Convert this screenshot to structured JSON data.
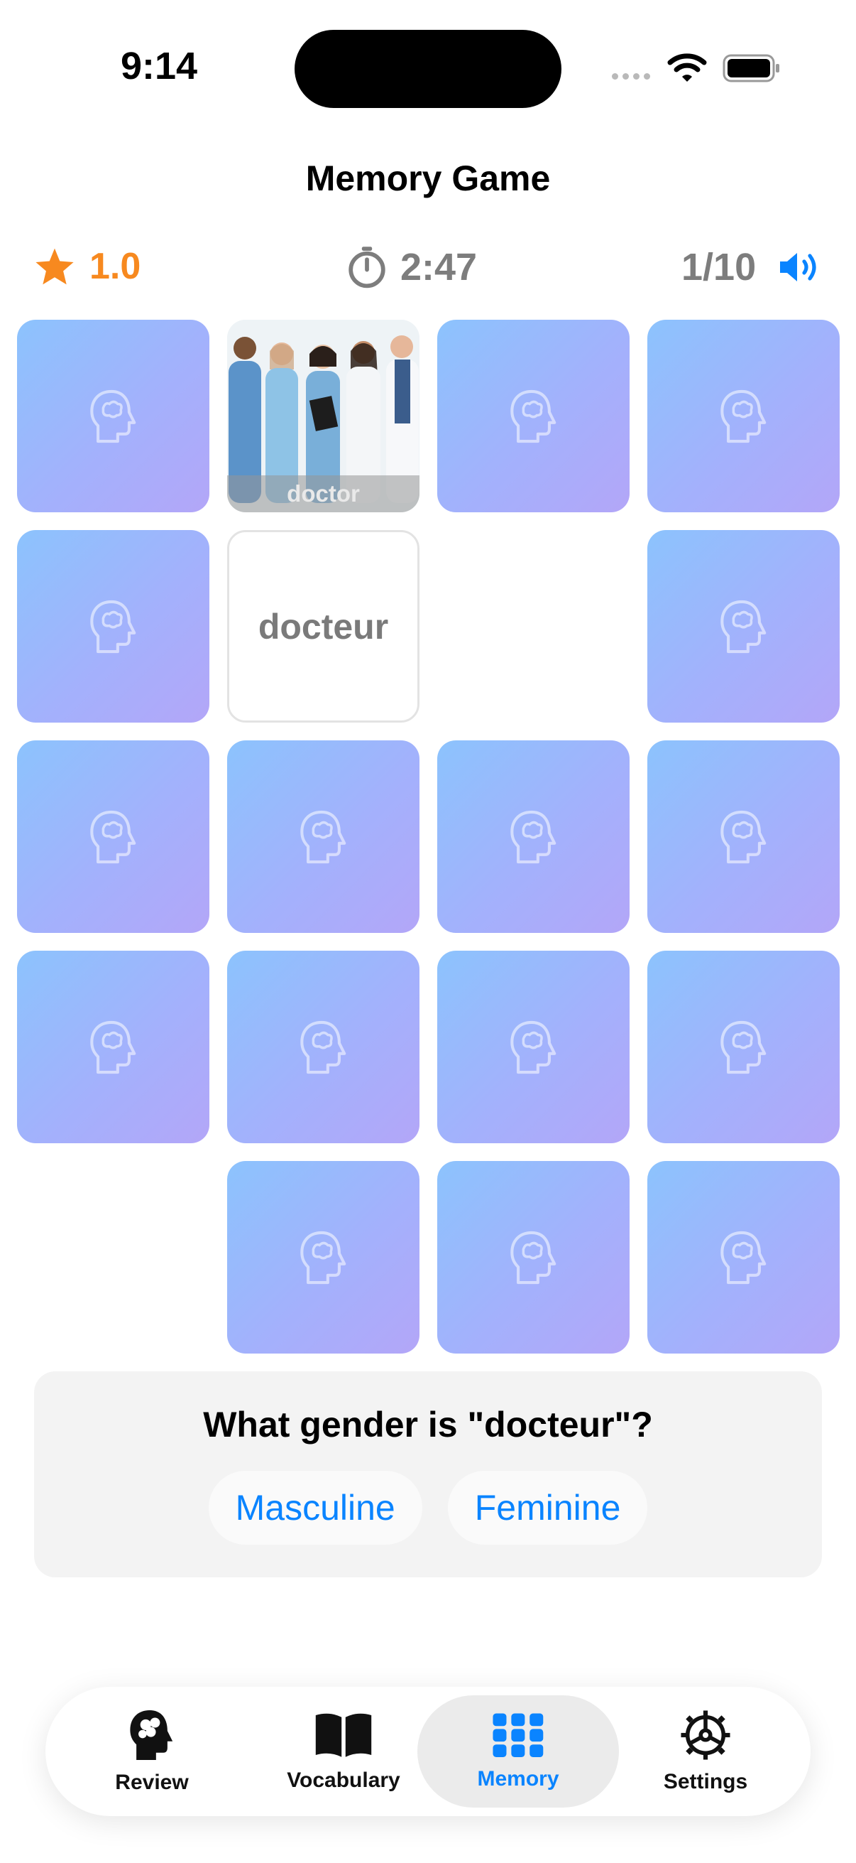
{
  "status_bar": {
    "time": "9:14"
  },
  "header": {
    "title": "Memory Game"
  },
  "stats": {
    "score": "1.0",
    "timer": "2:47",
    "progress": "1/10"
  },
  "grid": {
    "tiles": [
      {
        "state": "hidden"
      },
      {
        "state": "image",
        "caption": "doctor"
      },
      {
        "state": "hidden"
      },
      {
        "state": "hidden"
      },
      {
        "state": "hidden"
      },
      {
        "state": "word",
        "text": "docteur"
      },
      {
        "state": "matched"
      },
      {
        "state": "hidden"
      },
      {
        "state": "hidden"
      },
      {
        "state": "hidden"
      },
      {
        "state": "hidden"
      },
      {
        "state": "hidden"
      },
      {
        "state": "hidden"
      },
      {
        "state": "hidden"
      },
      {
        "state": "hidden"
      },
      {
        "state": "hidden"
      },
      {
        "state": "matched"
      },
      {
        "state": "hidden"
      },
      {
        "state": "hidden"
      },
      {
        "state": "hidden"
      }
    ]
  },
  "question": {
    "text": "What gender is \"docteur\"?",
    "options": [
      "Masculine",
      "Feminine"
    ]
  },
  "tabs": [
    {
      "label": "Review",
      "icon": "brain-head-icon"
    },
    {
      "label": "Vocabulary",
      "icon": "book-icon"
    },
    {
      "label": "Memory",
      "icon": "grid-icon",
      "active": true
    },
    {
      "label": "Settings",
      "icon": "gear-icon"
    }
  ],
  "colors": {
    "accent": "#0a84ff",
    "score": "#f7891f",
    "card_gradient_start": "#8cc3fd",
    "card_gradient_end": "#b3a6f8"
  }
}
